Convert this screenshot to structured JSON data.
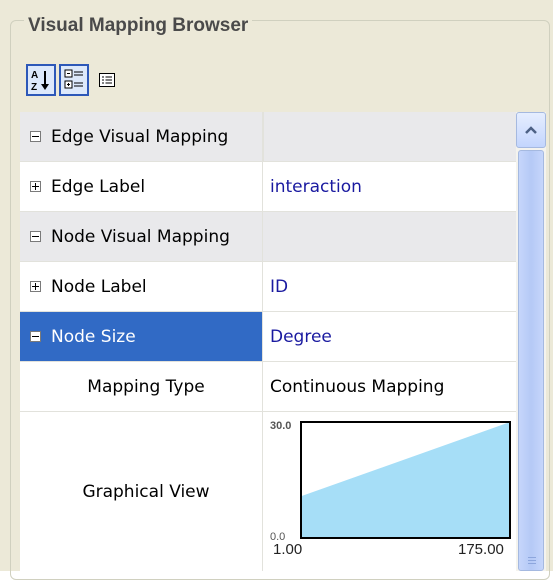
{
  "panel": {
    "title": "Visual Mapping Browser",
    "toolbar": [
      {
        "icon": "sort-alphabetical-icon",
        "pressed": true
      },
      {
        "icon": "categorized-view-icon",
        "pressed": true
      },
      {
        "icon": "property-sheet-icon",
        "pressed": false
      }
    ]
  },
  "grid": {
    "rows": [
      {
        "type": "category",
        "name": "Edge Visual Mapping",
        "expanded": true
      },
      {
        "type": "property",
        "name": "Edge Label",
        "value": "interaction",
        "expanded": false
      },
      {
        "type": "category",
        "name": "Node Visual Mapping",
        "expanded": true
      },
      {
        "type": "property",
        "name": "Node Label",
        "value": "ID",
        "expanded": false
      },
      {
        "type": "property",
        "name": "Node Size",
        "value": "Degree",
        "expanded": true,
        "selected": true
      },
      {
        "type": "subproperty",
        "name": "Mapping Type",
        "value": "Continuous Mapping"
      },
      {
        "type": "subproperty",
        "name": "Graphical View"
      }
    ]
  },
  "graph": {
    "y_max": "30.0",
    "y_min": "0.0",
    "x_min": "1.00",
    "x_max": "175.00",
    "line_start": 0.0,
    "line_end": 1.0,
    "line_start_frac": 0.36,
    "line_end_frac": 1.0,
    "fill_color": "#a6def7",
    "border_color": "#000000"
  },
  "scrollbar": {
    "up_icon": "chevron-up-icon"
  }
}
